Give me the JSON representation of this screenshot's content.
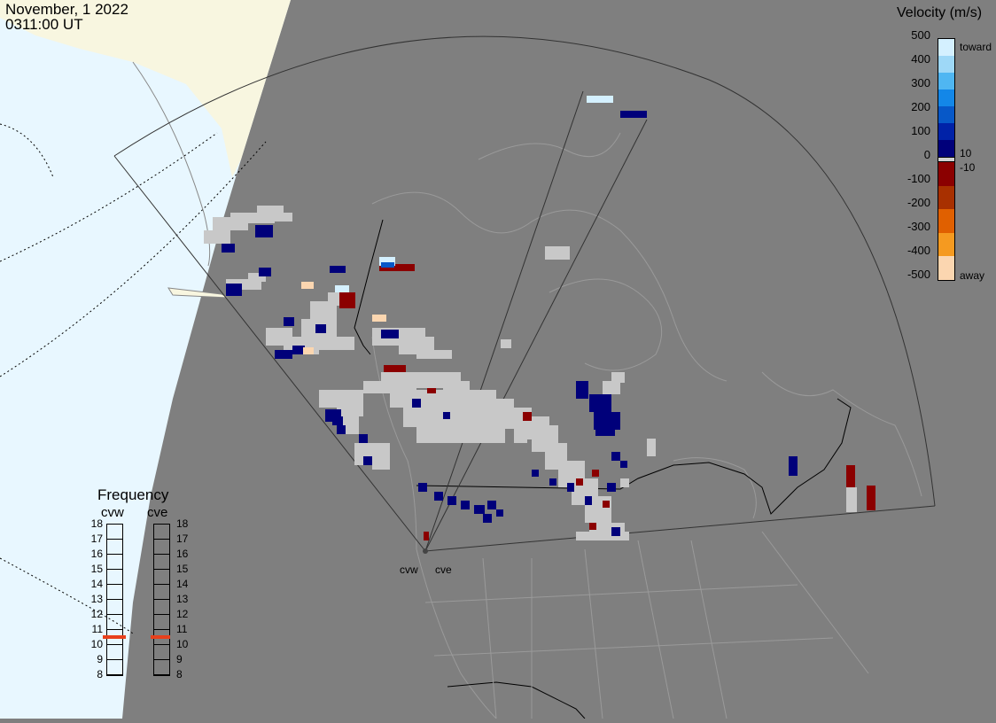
{
  "header": {
    "date": "November, 1 2022",
    "time": "0311:00 UT"
  },
  "velocity_scale": {
    "title": "Velocity (m/s)",
    "ticks": [
      "500",
      "400",
      "300",
      "200",
      "100",
      "0",
      "-100",
      "-200",
      "-300",
      "-400",
      "-500"
    ],
    "inner_ticks": [
      "10",
      "-10"
    ],
    "toward_label": "toward",
    "away_label": "away",
    "colors": [
      "#d4f0ff",
      "#9ed8f7",
      "#4fb6f2",
      "#1387e8",
      "#0758c8",
      "#0022a8",
      "#00007a",
      "#8b0000",
      "#a83000",
      "#e06000",
      "#f59a20",
      "#fbd6b0"
    ]
  },
  "frequency": {
    "title": "Frequency",
    "radars": [
      "cvw",
      "cve"
    ],
    "scale": [
      "18",
      "17",
      "16",
      "15",
      "14",
      "13",
      "12",
      "11",
      "10",
      "9",
      "8"
    ],
    "current_mhz": 10.5,
    "marker_color": "#e8401c"
  },
  "sites": [
    "cvw",
    "cve"
  ],
  "colors": {
    "ground_scatter": "#c8c8c8",
    "background": "#7f7f7f",
    "ocean": "#e8f7ff",
    "land_lit": "#f8f6e0"
  }
}
